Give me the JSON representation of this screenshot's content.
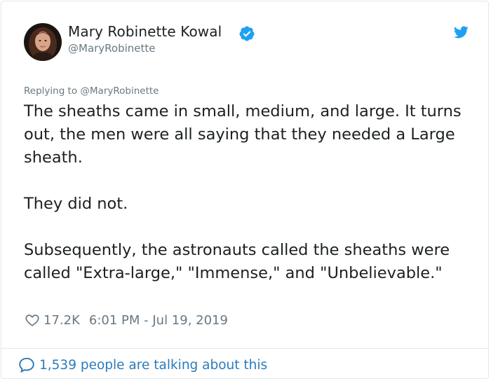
{
  "author": {
    "name": "Mary Robinette Kowal",
    "handle": "@MaryRobinette",
    "verified": true
  },
  "reply_to": "Replying to @MaryRobinette",
  "tweet": {
    "paragraphs": [
      "The sheaths came in small, medium, and large. It turns out, the men were all saying that they needed a Large sheath.",
      "They did not.",
      "Subsequently, the astronauts called the sheaths were called \"Extra-large,\" \"Immense,\" and \"Unbelievable.\""
    ]
  },
  "meta": {
    "likes": "17.2K",
    "timestamp": "6:01 PM - Jul 19, 2019"
  },
  "footer": {
    "talking": "1,539 people are talking about this"
  },
  "icons": {
    "verified": "verified-badge-icon",
    "bird": "twitter-bird-icon",
    "heart": "heart-icon",
    "bubble": "speech-bubble-icon"
  },
  "colors": {
    "twitter_blue": "#1da1f2",
    "link_blue": "#2b7bb9",
    "muted": "#697882",
    "text": "#1c2022",
    "border": "#e1e8ed"
  }
}
